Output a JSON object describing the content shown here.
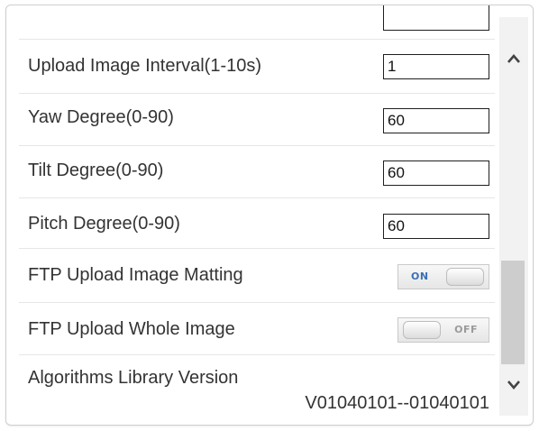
{
  "settings": {
    "rows": [
      {
        "label": "Upload Image Interval(1-10s)",
        "value": "1"
      },
      {
        "label": "Yaw Degree(0-90)",
        "value": "60"
      },
      {
        "label": "Tilt Degree(0-90)",
        "value": "60"
      },
      {
        "label": "Pitch Degree(0-90)",
        "value": "60"
      }
    ],
    "toggles": [
      {
        "label": "FTP Upload Image Matting",
        "state": "ON"
      },
      {
        "label": "FTP Upload Whole Image",
        "state": "OFF"
      }
    ],
    "version": {
      "label": "Algorithms Library Version",
      "value": "V01040101--01040101"
    }
  },
  "icons": {
    "scroll_up": "chevron-up-icon",
    "scroll_down": "chevron-down-icon"
  },
  "colors": {
    "on_text": "#3a6fb5",
    "off_text": "#9a9a9a",
    "scrollbar_thumb": "#cdcdcd"
  }
}
